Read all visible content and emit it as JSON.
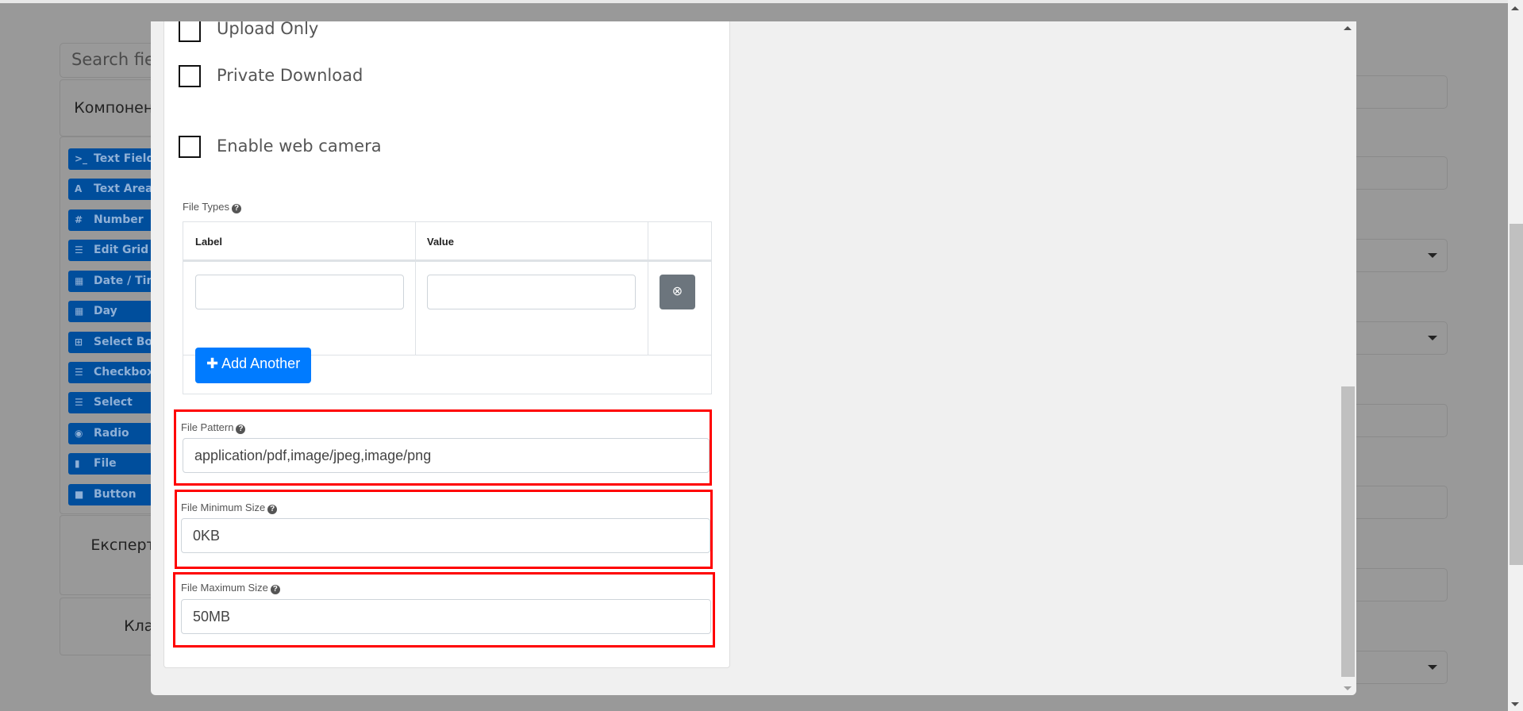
{
  "background": {
    "search_placeholder": "Search field(s)",
    "panels": [
      "Компоненти",
      "Експерт",
      "Клас"
    ],
    "components": [
      {
        "icon": "terminal-icon",
        "glyph": ">_",
        "label": "Text Field"
      },
      {
        "icon": "font-icon",
        "glyph": "A",
        "label": "Text Area"
      },
      {
        "icon": "hashtag-icon",
        "glyph": "#",
        "label": "Number"
      },
      {
        "icon": "tasks-icon",
        "glyph": "☰",
        "label": "Edit Grid"
      },
      {
        "icon": "calendar-icon",
        "glyph": "▦",
        "label": "Date / Time"
      },
      {
        "icon": "calendar-icon",
        "glyph": "▦",
        "label": "Day"
      },
      {
        "icon": "plus-square-icon",
        "glyph": "⊞",
        "label": "Select Boxes"
      },
      {
        "icon": "list-icon",
        "glyph": "☰",
        "label": "Checkbox"
      },
      {
        "icon": "list-icon",
        "glyph": "☰",
        "label": "Select"
      },
      {
        "icon": "dot-circle-icon",
        "glyph": "◉",
        "label": "Radio"
      },
      {
        "icon": "file-icon",
        "glyph": "▮",
        "label": "File"
      },
      {
        "icon": "stop-icon",
        "glyph": "■",
        "label": "Button"
      }
    ]
  },
  "modal": {
    "checkboxes": [
      {
        "label": "Upload Only",
        "checked": false
      },
      {
        "label": "Private Download",
        "checked": false
      },
      {
        "label": "Enable web camera",
        "checked": false
      }
    ],
    "file_types": {
      "label": "File Types",
      "columns": [
        "Label",
        "Value"
      ],
      "rows": [
        {
          "label": "",
          "value": ""
        }
      ],
      "add_button": "Add Another",
      "add_icon": "plus-icon",
      "remove_icon": "times-circle-icon"
    },
    "file_pattern": {
      "label": "File Pattern",
      "value": "application/pdf,image/jpeg,image/png"
    },
    "file_min_size": {
      "label": "File Minimum Size",
      "value": "0KB"
    },
    "file_max_size": {
      "label": "File Maximum Size",
      "value": "50MB"
    },
    "help_glyph": "?",
    "highlight_color": "#ff0000",
    "accent_color": "#007bff"
  }
}
